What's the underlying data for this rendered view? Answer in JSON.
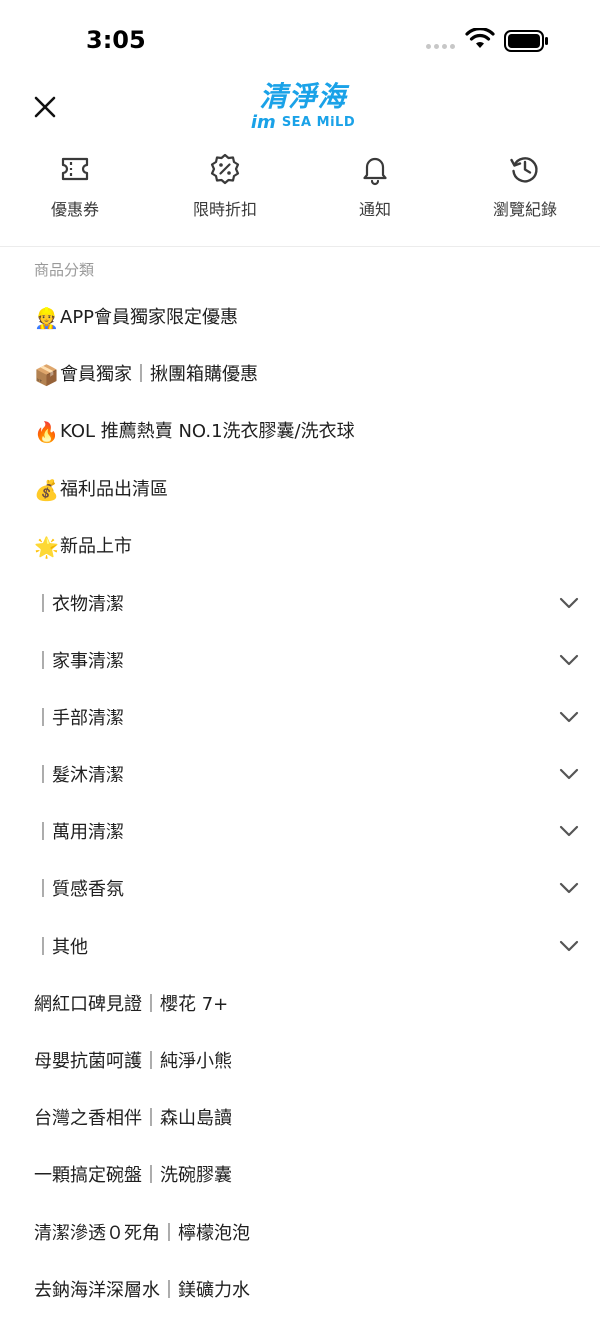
{
  "status": {
    "time": "3:05"
  },
  "header": {
    "logo_zh": "清淨海",
    "logo_mark": "im",
    "logo_en": "SEA MiLD"
  },
  "quick_actions": [
    {
      "label": "優惠券",
      "icon": "coupon-icon"
    },
    {
      "label": "限時折扣",
      "icon": "discount-badge-icon"
    },
    {
      "label": "通知",
      "icon": "bell-icon"
    },
    {
      "label": "瀏覽紀錄",
      "icon": "history-icon"
    }
  ],
  "section_label": "商品分類",
  "menu": [
    {
      "emoji": "👷",
      "label": "APP會員獨家限定優惠",
      "expandable": false
    },
    {
      "emoji": "📦",
      "label": "會員獨家｜揪團箱購優惠",
      "expandable": false
    },
    {
      "emoji": "🔥",
      "label": "KOL 推薦熱賣 NO.1洗衣膠囊/洗衣球",
      "expandable": false
    },
    {
      "emoji": "💰",
      "label": "福利品出清區",
      "expandable": false
    },
    {
      "emoji": "🌟",
      "label": "新品上市",
      "expandable": false
    },
    {
      "emoji": "",
      "label": "｜衣物清潔",
      "expandable": true
    },
    {
      "emoji": "",
      "label": "｜家事清潔",
      "expandable": true
    },
    {
      "emoji": "",
      "label": "｜手部清潔",
      "expandable": true
    },
    {
      "emoji": "",
      "label": "｜髮沐清潔",
      "expandable": true
    },
    {
      "emoji": "",
      "label": "｜萬用清潔",
      "expandable": true
    },
    {
      "emoji": "",
      "label": "｜質感香氛",
      "expandable": true
    },
    {
      "emoji": "",
      "label": "｜其他",
      "expandable": true
    },
    {
      "emoji": "",
      "label": "網紅口碑見證｜櫻花 7+",
      "expandable": false
    },
    {
      "emoji": "",
      "label": "母嬰抗菌呵護｜純淨小熊",
      "expandable": false
    },
    {
      "emoji": "",
      "label": "台灣之香相伴｜森山島讀",
      "expandable": false
    },
    {
      "emoji": "",
      "label": "一顆搞定碗盤｜洗碗膠囊",
      "expandable": false
    },
    {
      "emoji": "",
      "label": "清潔滲透０死角｜檸檬泡泡",
      "expandable": false
    },
    {
      "emoji": "",
      "label": "去鈉海洋深層水｜鎂礦力水",
      "expandable": false
    }
  ],
  "colors": {
    "brand": "#1aa2e8",
    "icon": "#3a3a3a",
    "muted": "#9a9a9a"
  }
}
